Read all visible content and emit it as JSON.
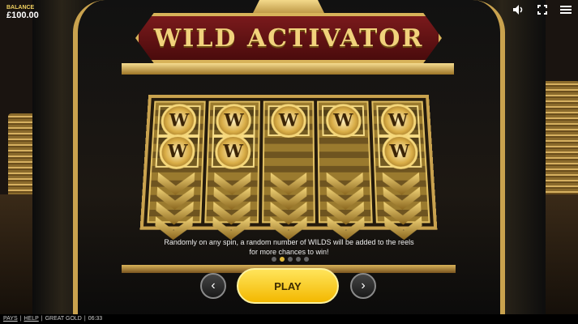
{
  "balance": {
    "label": "BALANCE",
    "value": "£100.00"
  },
  "top_controls": {
    "sound_icon": "speaker-icon",
    "fullscreen_icon": "fullscreen-icon",
    "menu_icon": "hamburger-menu-icon"
  },
  "title": "WILD ACTIVATOR",
  "reels": {
    "count": 5,
    "symbol": "W",
    "wild_rows": [
      2,
      2,
      1,
      1,
      2
    ]
  },
  "description": {
    "line1": "Randomly on any spin, a random number of WILDS will be added to the reels",
    "line2": "for more chances to win!"
  },
  "pagination": {
    "total": 5,
    "active": 2
  },
  "controls": {
    "prev_label": "‹",
    "play_label": "PLAY",
    "next_label": "›"
  },
  "footer": {
    "pays": "PAYS",
    "help": "HELP",
    "game_name": "GREAT GOLD",
    "time": "06:33",
    "separator": "|"
  },
  "colors": {
    "gold": "#c9a24e",
    "title_red": "#7a1a1c",
    "play_yellow": "#f3b800"
  }
}
